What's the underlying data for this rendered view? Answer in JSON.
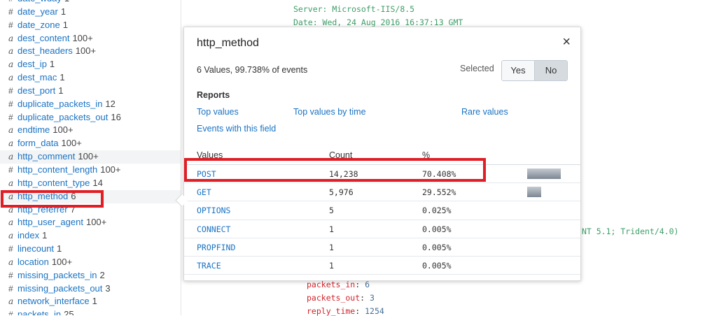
{
  "sidebar": {
    "fields": [
      {
        "type": "#",
        "name": "date_wday",
        "count": "1"
      },
      {
        "type": "#",
        "name": "date_year",
        "count": "1"
      },
      {
        "type": "#",
        "name": "date_zone",
        "count": "1"
      },
      {
        "type": "a",
        "name": "dest_content",
        "count": "100+"
      },
      {
        "type": "a",
        "name": "dest_headers",
        "count": "100+"
      },
      {
        "type": "a",
        "name": "dest_ip",
        "count": "1"
      },
      {
        "type": "a",
        "name": "dest_mac",
        "count": "1"
      },
      {
        "type": "#",
        "name": "dest_port",
        "count": "1"
      },
      {
        "type": "#",
        "name": "duplicate_packets_in",
        "count": "12"
      },
      {
        "type": "#",
        "name": "duplicate_packets_out",
        "count": "16"
      },
      {
        "type": "a",
        "name": "endtime",
        "count": "100+"
      },
      {
        "type": "a",
        "name": "form_data",
        "count": "100+"
      },
      {
        "type": "a",
        "name": "http_comment",
        "count": "100+"
      },
      {
        "type": "#",
        "name": "http_content_length",
        "count": "100+"
      },
      {
        "type": "a",
        "name": "http_content_type",
        "count": "14"
      },
      {
        "type": "a",
        "name": "http_method",
        "count": "6"
      },
      {
        "type": "a",
        "name": "http_referrer",
        "count": "7"
      },
      {
        "type": "a",
        "name": "http_user_agent",
        "count": "100+"
      },
      {
        "type": "a",
        "name": "index",
        "count": "1"
      },
      {
        "type": "#",
        "name": "linecount",
        "count": "1"
      },
      {
        "type": "a",
        "name": "location",
        "count": "100+"
      },
      {
        "type": "#",
        "name": "missing_packets_in",
        "count": "2"
      },
      {
        "type": "#",
        "name": "missing_packets_out",
        "count": "3"
      },
      {
        "type": "a",
        "name": "network_interface",
        "count": "1"
      },
      {
        "type": "#",
        "name": "packets_in",
        "count": "25"
      }
    ]
  },
  "event": {
    "server_line": "Server: Microsoft-IIS/8.5",
    "date_line": "Date: Wed, 24 Aug 2016 16:37:13 GMT",
    "agent_tail": "NT 5.1; Trident/4.0)",
    "kv": [
      {
        "key": "packets_in",
        "value": "6"
      },
      {
        "key": "packets_out",
        "value": "3"
      },
      {
        "key": "reply_time",
        "value": "1254"
      }
    ]
  },
  "popup": {
    "title": "http_method",
    "close": "×",
    "summary": "6 Values, 99.738% of events",
    "selected_label": "Selected",
    "toggle_yes": "Yes",
    "toggle_no": "No",
    "toggle_active": "No",
    "reports_label": "Reports",
    "reports": {
      "top_values": "Top values",
      "top_values_by_time": "Top values by time",
      "rare_values": "Rare values",
      "events_with_field": "Events with this field"
    },
    "table": {
      "headers": {
        "values": "Values",
        "count": "Count",
        "percent": "%"
      },
      "rows": [
        {
          "value": "POST",
          "count": "14,238",
          "percent": "70.408%",
          "pct_num": 70.408
        },
        {
          "value": "GET",
          "count": "5,976",
          "percent": "29.552%",
          "pct_num": 29.552
        },
        {
          "value": "OPTIONS",
          "count": "5",
          "percent": "0.025%",
          "pct_num": 0.025
        },
        {
          "value": "CONNECT",
          "count": "1",
          "percent": "0.005%",
          "pct_num": 0.005
        },
        {
          "value": "PROPFIND",
          "count": "1",
          "percent": "0.005%",
          "pct_num": 0.005
        },
        {
          "value": "TRACE",
          "count": "1",
          "percent": "0.005%",
          "pct_num": 0.005
        }
      ]
    }
  },
  "colors": {
    "link": "#1a73c4",
    "annotation_red": "#e01e25",
    "event_green": "#3e9e68",
    "event_key_red": "#d2242a"
  }
}
